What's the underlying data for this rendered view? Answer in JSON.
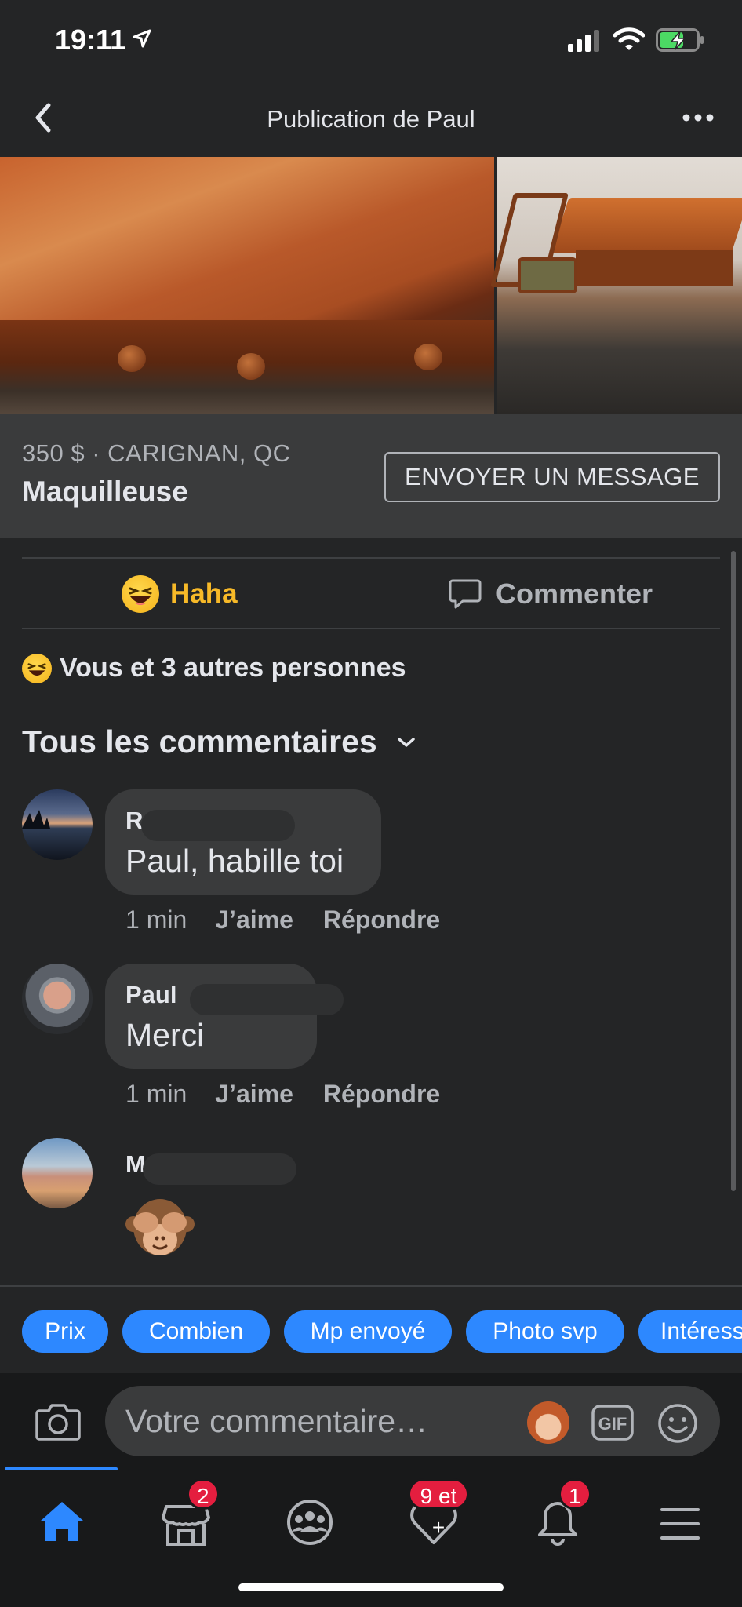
{
  "status_bar": {
    "time": "19:11"
  },
  "header": {
    "title": "Publication de Paul"
  },
  "listing": {
    "meta": "350 $ · CARIGNAN, QC",
    "title": "Maquilleuse",
    "message_button": "ENVOYER UN MESSAGE"
  },
  "actions": {
    "haha_label": "Haha",
    "comment_label": "Commenter"
  },
  "reactions": {
    "summary": "Vous et 3 autres personnes"
  },
  "comments_heading": "Tous les commentaires",
  "comments": [
    {
      "name": "R",
      "text": "Paul, habille toi",
      "time": "1 min",
      "like": "J’aime",
      "reply": "Répondre"
    },
    {
      "name": "Paul",
      "text": "Merci",
      "time": "1 min",
      "like": "J’aime",
      "reply": "Répondre"
    },
    {
      "name": "M",
      "emoji": "see-no-evil-monkey-icon"
    }
  ],
  "quick_replies": [
    "Prix",
    "Combien",
    "Mp envoyé",
    "Photo svp",
    "Intéressé"
  ],
  "composer": {
    "placeholder": "Votre commentaire…"
  },
  "tabbar": {
    "marketplace_badge": "2",
    "dating_badge": "9 et +",
    "notifications_badge": "1"
  },
  "colors": {
    "accent": "#2d88ff",
    "haha": "#f7b928",
    "badge": "#e41e3f",
    "background": "#242526"
  }
}
